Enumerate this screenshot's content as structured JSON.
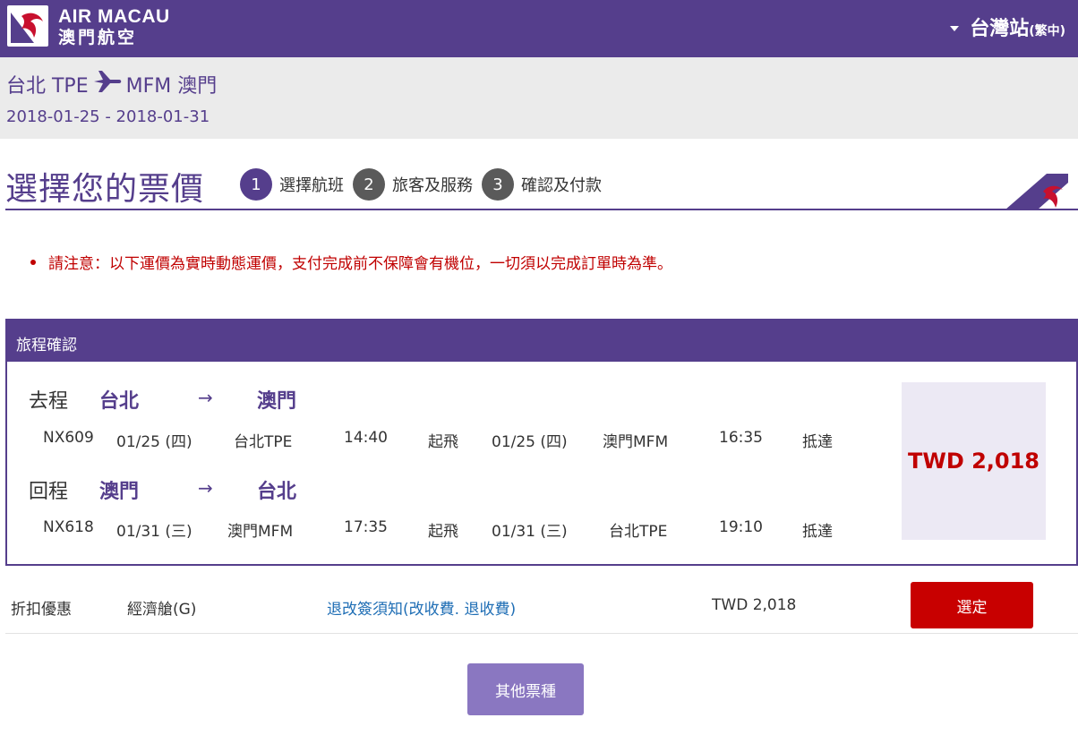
{
  "header": {
    "logo_en": "AIR MACAU",
    "logo_zh": "澳門航空",
    "site_name": "台灣站",
    "site_lang": "(繁中)"
  },
  "route": {
    "origin": "台北 TPE",
    "destination": "MFM 澳門",
    "dates": "2018-01-25 - 2018-01-31"
  },
  "page": {
    "title": "選擇您的票價",
    "steps": [
      {
        "num": "1",
        "label": "選擇航班",
        "active": true
      },
      {
        "num": "2",
        "label": "旅客及服務",
        "active": false
      },
      {
        "num": "3",
        "label": "確認及付款",
        "active": false
      }
    ]
  },
  "notice": "請注意：以下運價為實時動態運價，支付完成前不保障會有機位，一切須以完成訂單時為準。",
  "itinerary": {
    "title": "旅程確認",
    "arrow": "→",
    "outbound": {
      "label": "去程",
      "from_city": "台北",
      "to_city": "澳門",
      "flight_no": "NX609",
      "dep_date": "01/25 (四)",
      "dep_airport": "台北TPE",
      "dep_time": "14:40",
      "dep_word": "起飛",
      "arr_date": "01/25 (四)",
      "arr_airport": "澳門MFM",
      "arr_time": "16:35",
      "arr_word": "抵達"
    },
    "return": {
      "label": "回程",
      "from_city": "澳門",
      "to_city": "台北",
      "flight_no": "NX618",
      "dep_date": "01/31 (三)",
      "dep_airport": "澳門MFM",
      "dep_time": "17:35",
      "dep_word": "起飛",
      "arr_date": "01/31 (三)",
      "arr_airport": "台北TPE",
      "arr_time": "19:10",
      "arr_word": "抵達"
    },
    "total_price": "TWD 2,018"
  },
  "fare": {
    "type": "折扣優惠",
    "cabin": "經濟艙(G)",
    "rules_link": "退改簽須知(改收費. 退收費)",
    "price": "TWD 2,018",
    "select_label": "選定"
  },
  "other_fares_label": "其他票種",
  "colors": {
    "brand": "#553e8c",
    "accent_red": "#c80000",
    "link": "#1f6eb5"
  }
}
